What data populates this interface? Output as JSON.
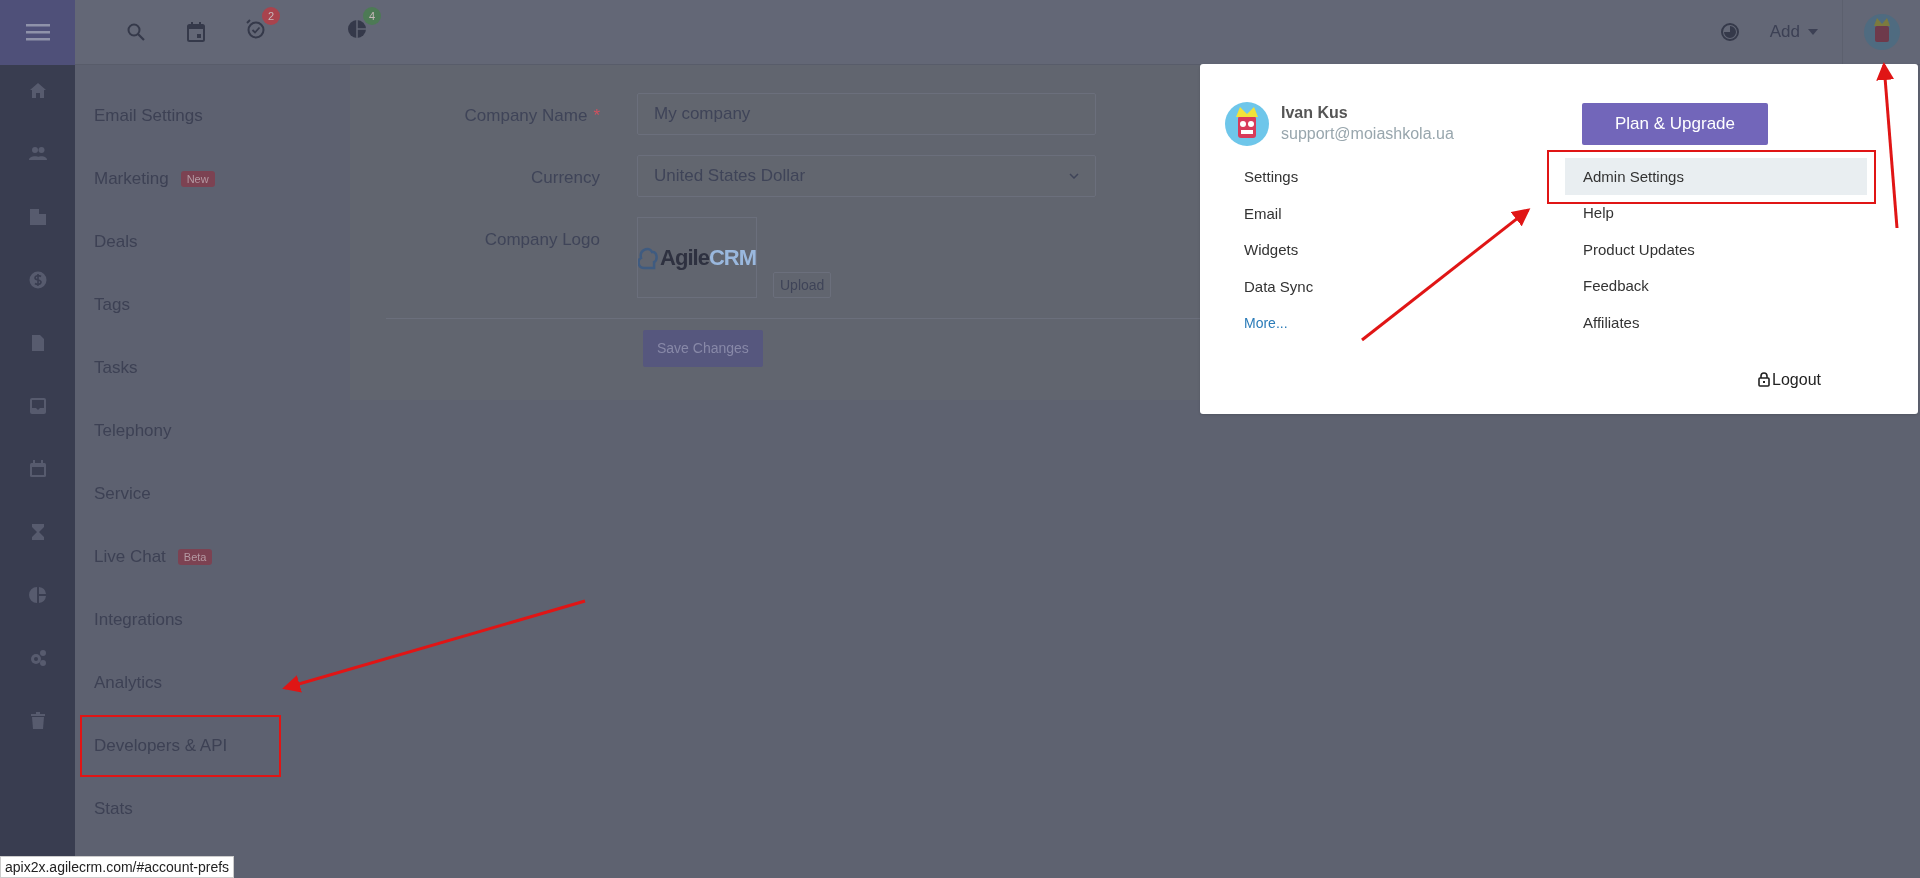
{
  "topbar": {
    "notifications": [
      {
        "kind": "reminders",
        "badge": "2",
        "color": "#a9434d"
      },
      {
        "kind": "reports",
        "badge": "4",
        "color": "#4d7a55"
      }
    ],
    "add_menu": "Add"
  },
  "settings_nav": [
    {
      "label": "Email Settings"
    },
    {
      "label": "Marketing",
      "badge": "New"
    },
    {
      "label": "Deals"
    },
    {
      "label": "Tags"
    },
    {
      "label": "Tasks"
    },
    {
      "label": "Telephony"
    },
    {
      "label": "Service"
    },
    {
      "label": "Live Chat",
      "badge": "Beta"
    },
    {
      "label": "Integrations"
    },
    {
      "label": "Analytics"
    },
    {
      "label": "Developers & API"
    },
    {
      "label": "Stats"
    }
  ],
  "form": {
    "company_name": {
      "label": "Company Name",
      "required_mark": "*",
      "value": "My company"
    },
    "currency": {
      "label": "Currency",
      "value": "United States Dollar"
    },
    "company_logo": {
      "label": "Company Logo",
      "logo_word_1": "Agile",
      "logo_word_2": "CRM",
      "upload_button": "Upload"
    },
    "save_button": "Save Changes"
  },
  "user_menu": {
    "name": "Ivan Kus",
    "email": "support@moiashkola.ua",
    "plan_button": "Plan & Upgrade",
    "left_items": [
      {
        "label": "Settings",
        "kind": "item"
      },
      {
        "label": "Email",
        "kind": "item"
      },
      {
        "label": "Widgets",
        "kind": "item"
      },
      {
        "label": "Data Sync",
        "kind": "item"
      },
      {
        "label": "More...",
        "kind": "link"
      }
    ],
    "right_items": [
      {
        "label": "Admin Settings",
        "selected": true
      },
      {
        "label": "Help",
        "selected": false
      },
      {
        "label": "Product Updates",
        "selected": false
      },
      {
        "label": "Feedback",
        "selected": false
      },
      {
        "label": "Affiliates",
        "selected": false
      }
    ],
    "logout": "Logout"
  },
  "status_url": "apix2x.agilecrm.com/#account-prefs"
}
